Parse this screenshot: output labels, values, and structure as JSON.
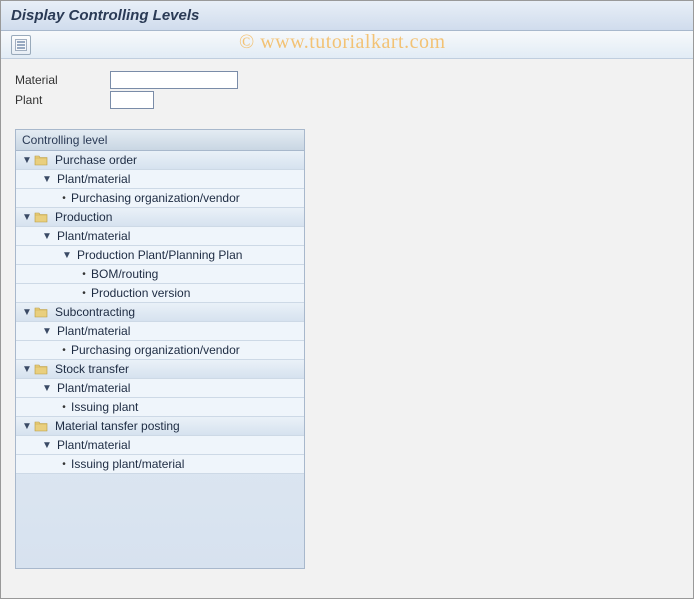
{
  "header": {
    "title": "Display Controlling Levels"
  },
  "form": {
    "material_label": "Material",
    "material_value": "",
    "plant_label": "Plant",
    "plant_value": ""
  },
  "tree": {
    "header": "Controlling level",
    "nodes": [
      {
        "type": "folder",
        "level": 1,
        "label": "Purchase order"
      },
      {
        "type": "branch",
        "level": 2,
        "label": "Plant/material"
      },
      {
        "type": "leaf",
        "level": 3,
        "label": "Purchasing organization/vendor"
      },
      {
        "type": "folder",
        "level": 1,
        "label": "Production"
      },
      {
        "type": "branch",
        "level": 2,
        "label": "Plant/material"
      },
      {
        "type": "branch",
        "level": 3,
        "label": "Production Plant/Planning Plan"
      },
      {
        "type": "leaf",
        "level": 4,
        "label": "BOM/routing"
      },
      {
        "type": "leaf",
        "level": 4,
        "label": "Production version"
      },
      {
        "type": "folder",
        "level": 1,
        "label": "Subcontracting"
      },
      {
        "type": "branch",
        "level": 2,
        "label": "Plant/material"
      },
      {
        "type": "leaf",
        "level": 3,
        "label": "Purchasing organization/vendor"
      },
      {
        "type": "folder",
        "level": 1,
        "label": "Stock transfer"
      },
      {
        "type": "branch",
        "level": 2,
        "label": "Plant/material"
      },
      {
        "type": "leaf",
        "level": 3,
        "label": "Issuing plant"
      },
      {
        "type": "folder",
        "level": 1,
        "label": "Material tansfer posting"
      },
      {
        "type": "branch",
        "level": 2,
        "label": "Plant/material"
      },
      {
        "type": "leaf",
        "level": 3,
        "label": "Issuing plant/material"
      }
    ]
  },
  "watermark": "© www.tutorialkart.com"
}
